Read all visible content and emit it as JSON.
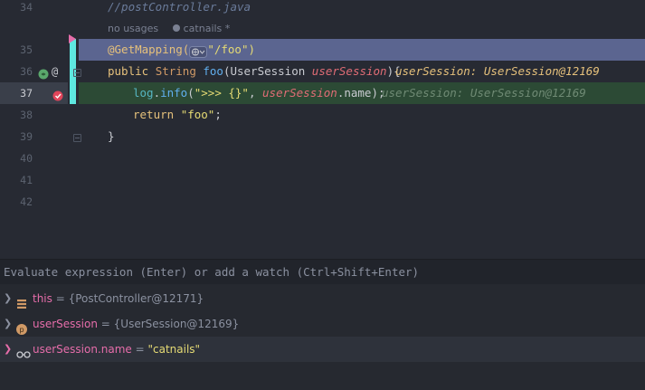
{
  "editor": {
    "lines": [
      {
        "num": "34",
        "code": "//postController.java"
      },
      {
        "hint_usages": "no usages",
        "hint_author": "catnails *"
      },
      {
        "num": "35",
        "code": "@GetMapping(",
        "code2": "\"/foo\")"
      },
      {
        "num": "36",
        "code_pre": "public ",
        "code_type": "String ",
        "code_meth": "foo",
        "code_p1": "(UserSession ",
        "code_param": "userSession",
        "code_p2": "){",
        "inlay": "userSession: UserSession@12169"
      },
      {
        "num": "37",
        "code_obj": "log",
        "code_dot": ".",
        "code_meth": "info",
        "code_open": "(",
        "code_str": "\">>> {}\"",
        "code_comma": ", ",
        "code_param": "userSession",
        "code_field": ".name",
        "code_close": ");",
        "inlay": "userSession: UserSession@12169"
      },
      {
        "num": "38",
        "code_kw": "return ",
        "code_str": "\"foo\"",
        "code_end": ";"
      },
      {
        "num": "39",
        "code": "}"
      },
      {
        "num": "40"
      },
      {
        "num": "41"
      },
      {
        "num": "42"
      }
    ],
    "annotation_symbol": "@"
  },
  "evaluate": {
    "placeholder": "Evaluate expression (Enter) or add a watch (Ctrl+Shift+Enter)"
  },
  "variables": [
    {
      "name": "this",
      "eq": " = ",
      "value": "{PostController@12171}",
      "icon": "fields-icon"
    },
    {
      "name": "userSession",
      "eq": " = ",
      "value": "{UserSession@12169}",
      "icon": "parameter-icon"
    },
    {
      "name": "userSession.name",
      "eq": " = ",
      "value": "\"catnails\"",
      "icon": "watch-glasses-icon"
    }
  ],
  "colors": {
    "accent_pink": "#e66daa",
    "change_bar": "#5ee8e0",
    "highlight_blue": "#5b6590",
    "highlight_green": "#2c4a35"
  }
}
